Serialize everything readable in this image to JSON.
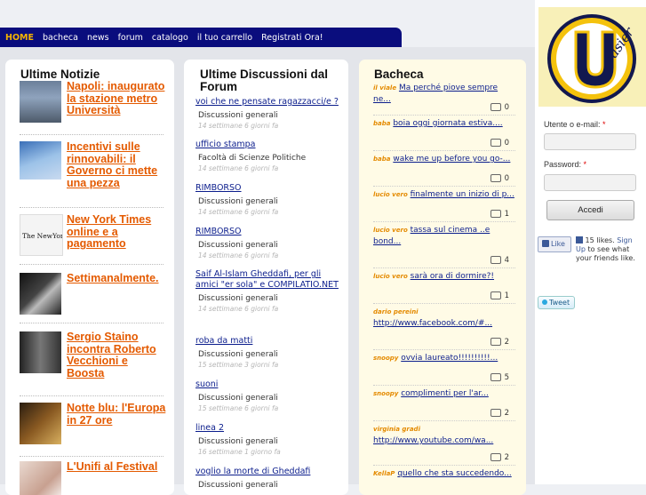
{
  "nav": {
    "items": [
      "HOME",
      "bacheca",
      "news",
      "forum",
      "catalogo",
      "il tuo carrello",
      "Registrati Ora!"
    ]
  },
  "news": {
    "title": "Ultime Notizie",
    "items": [
      {
        "title": "Napoli: inaugurato la stazione metro Università"
      },
      {
        "title": "Incentivi sulle rinnovabili: il Governo ci mette una pezza"
      },
      {
        "title": "New York Times online e a pagamento"
      },
      {
        "title": "Settimanalmente."
      },
      {
        "title": "Sergio Staino incontra Roberto Vecchioni e Boosta"
      },
      {
        "title": "Notte blu: l'Europa in 27 ore"
      },
      {
        "title": "L'Unifi al Festival"
      }
    ]
  },
  "forum": {
    "title": "Ultime Discussioni dal Forum",
    "items": [
      {
        "link": "voi che ne pensate ragazzacci/e ?",
        "category": "Discussioni generali",
        "date": "14 settimane 6 giorni fa"
      },
      {
        "link": "ufficio stampa",
        "category": "Facoltà di Scienze Politiche",
        "date": "14 settimane 6 giorni fa"
      },
      {
        "link": "RIMBORSO",
        "category": "Discussioni generali",
        "date": "14 settimane 6 giorni fa"
      },
      {
        "link": "RIMBORSO",
        "category": "Discussioni generali",
        "date": "14 settimane 6 giorni fa"
      },
      {
        "link": "Saif Al-Islam Gheddafi, per gli amici \"er sola\" e COMPILATIO.NET",
        "category": "Discussioni generali",
        "date": "14 settimane 6 giorni fa"
      },
      {
        "link": "roba da matti",
        "category": "Discussioni generali",
        "date": "15 settimane 3 giorni fa"
      },
      {
        "link": "suoni",
        "category": "Discussioni generali",
        "date": "15 settimane 6 giorni fa"
      },
      {
        "link": "linea 2",
        "category": "Discussioni generali",
        "date": "16 settimane 1 giorno fa"
      },
      {
        "link": "voglio la morte di Gheddafi",
        "category": "Discussioni generali",
        "date": ""
      }
    ]
  },
  "bacheca": {
    "title": "Bacheca",
    "items": [
      {
        "author": "il viale",
        "title": "Ma perché piove sempre ne...",
        "count": "0"
      },
      {
        "author": "baba",
        "title": "boia oggi giornata estiva....",
        "count": "0"
      },
      {
        "author": "baba",
        "title": "wake me up before you go-...",
        "count": "0"
      },
      {
        "author": "lucio vero",
        "title": "finalmente un inizio di p...",
        "count": "1"
      },
      {
        "author": "lucio vero",
        "title": "tassa sul cinema ..e bond...",
        "count": "4"
      },
      {
        "author": "lucio vero",
        "title": "sarà ora di dormire?!",
        "count": "1"
      },
      {
        "author": "dario pereini",
        "title": "http://www.facebook.com/#...",
        "count": "2"
      },
      {
        "author": "snoopy",
        "title": "ovvia laureato!!!!!!!!!!...",
        "count": "5"
      },
      {
        "author": "snoopy",
        "title": "complimenti per l'ar...",
        "count": "2"
      },
      {
        "author": "virginia gradi",
        "title": "http://www.youtube.com/wa...",
        "count": "2"
      },
      {
        "author": "KellaP",
        "title": "quello che sta succedendo...",
        "count": ""
      }
    ]
  },
  "logo": {
    "letter": "U",
    "word": "easier"
  },
  "login": {
    "user_label": "Utente o e-mail:",
    "pass_label": "Password:",
    "required": "*",
    "submit": "Accedi"
  },
  "social": {
    "like": "Like",
    "likes_text": "15 likes.",
    "signup": "Sign Up",
    "signup_rest": "to see what your friends like.",
    "tweet": "Tweet"
  },
  "colors": {
    "nav_bg": "#0a0d7d",
    "accent": "#e45a00",
    "link": "#0b1d8c",
    "home": "#f5b400"
  }
}
